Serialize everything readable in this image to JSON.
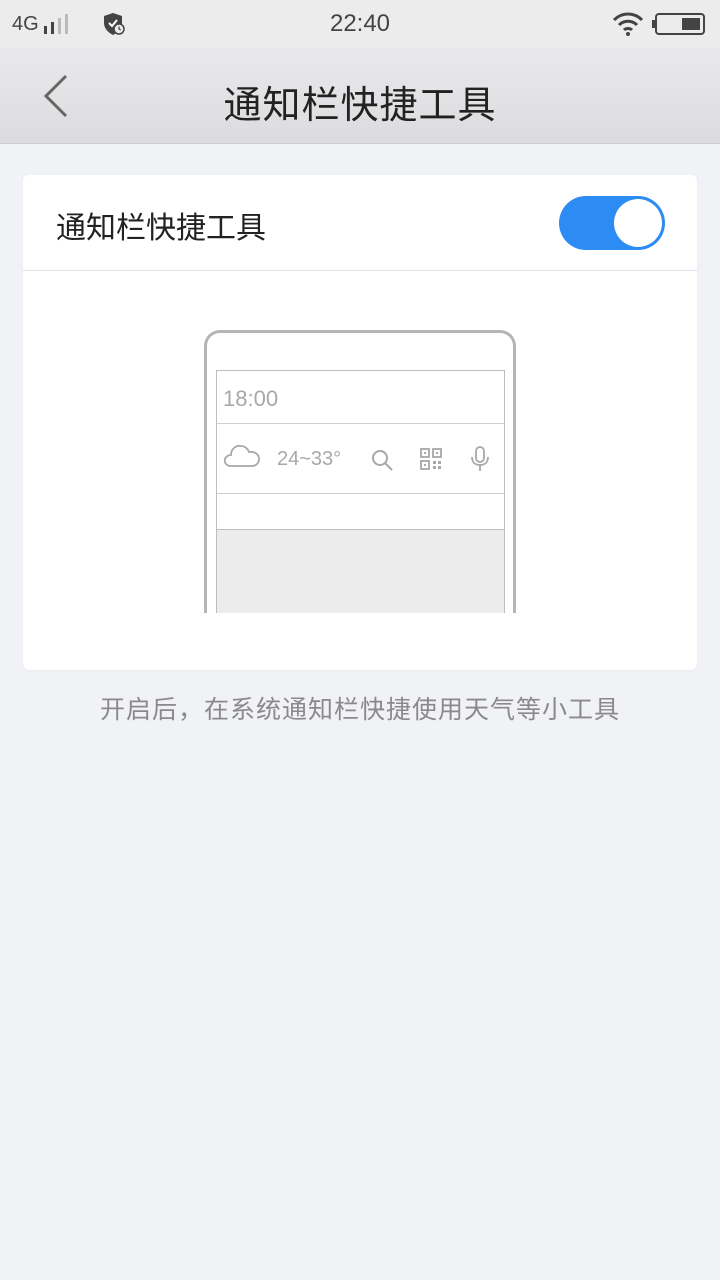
{
  "status_bar": {
    "network": "4G",
    "time": "22:40"
  },
  "header": {
    "title": "通知栏快捷工具"
  },
  "setting": {
    "label": "通知栏快捷工具",
    "enabled": true,
    "accent_color": "#2c8cf4"
  },
  "preview": {
    "time": "18:00",
    "temperature": "24~33°",
    "icons": [
      "cloud-icon",
      "search-icon",
      "qr-code-icon",
      "microphone-icon"
    ]
  },
  "description": "开启后，在系统通知栏快捷使用天气等小工具"
}
